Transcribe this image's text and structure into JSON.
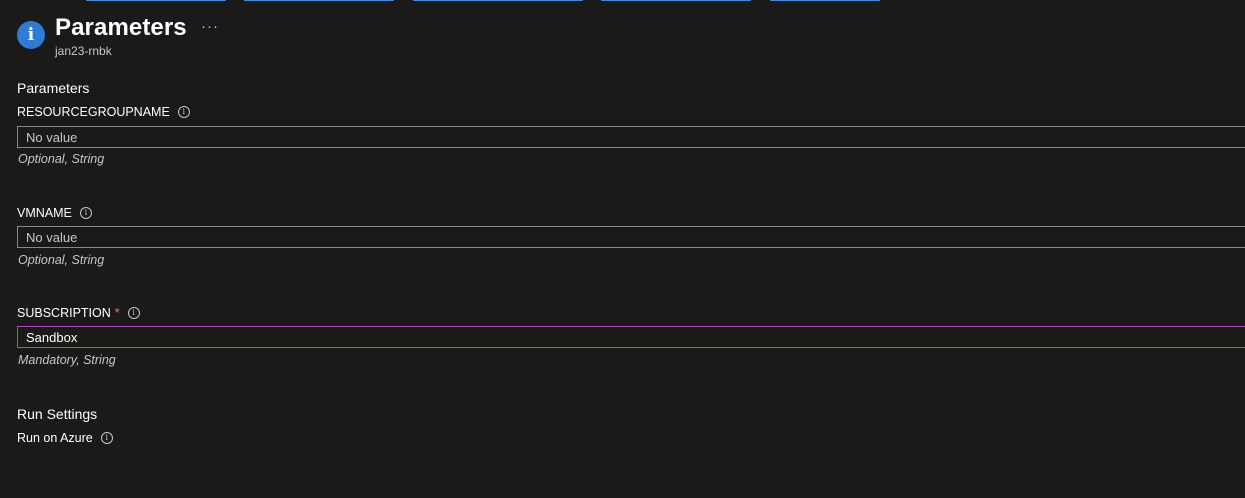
{
  "header": {
    "title": "Parameters",
    "subtitle": "jan23-rnbk",
    "more_label": "···",
    "icon": "info-icon"
  },
  "parameters_section": {
    "title": "Parameters",
    "fields": [
      {
        "label": "RESOURCEGROUPNAME",
        "required": false,
        "value": "",
        "placeholder": "No value",
        "hint": "Optional, String"
      },
      {
        "label": "VMNAME",
        "required": false,
        "value": "",
        "placeholder": "No value",
        "hint": "Optional, String"
      },
      {
        "label": "SUBSCRIPTION",
        "required": true,
        "required_mark": "*",
        "value": "Sandbox",
        "placeholder": "",
        "hint": "Mandatory, String"
      }
    ]
  },
  "run_settings": {
    "title": "Run Settings",
    "option_label": "Run on Azure"
  },
  "colors": {
    "background": "#1b1a19",
    "accent_blue": "#2f7cd6",
    "focus_border": "#b146c2",
    "required_star": "#f1707b",
    "input_border": "#8a8886"
  }
}
